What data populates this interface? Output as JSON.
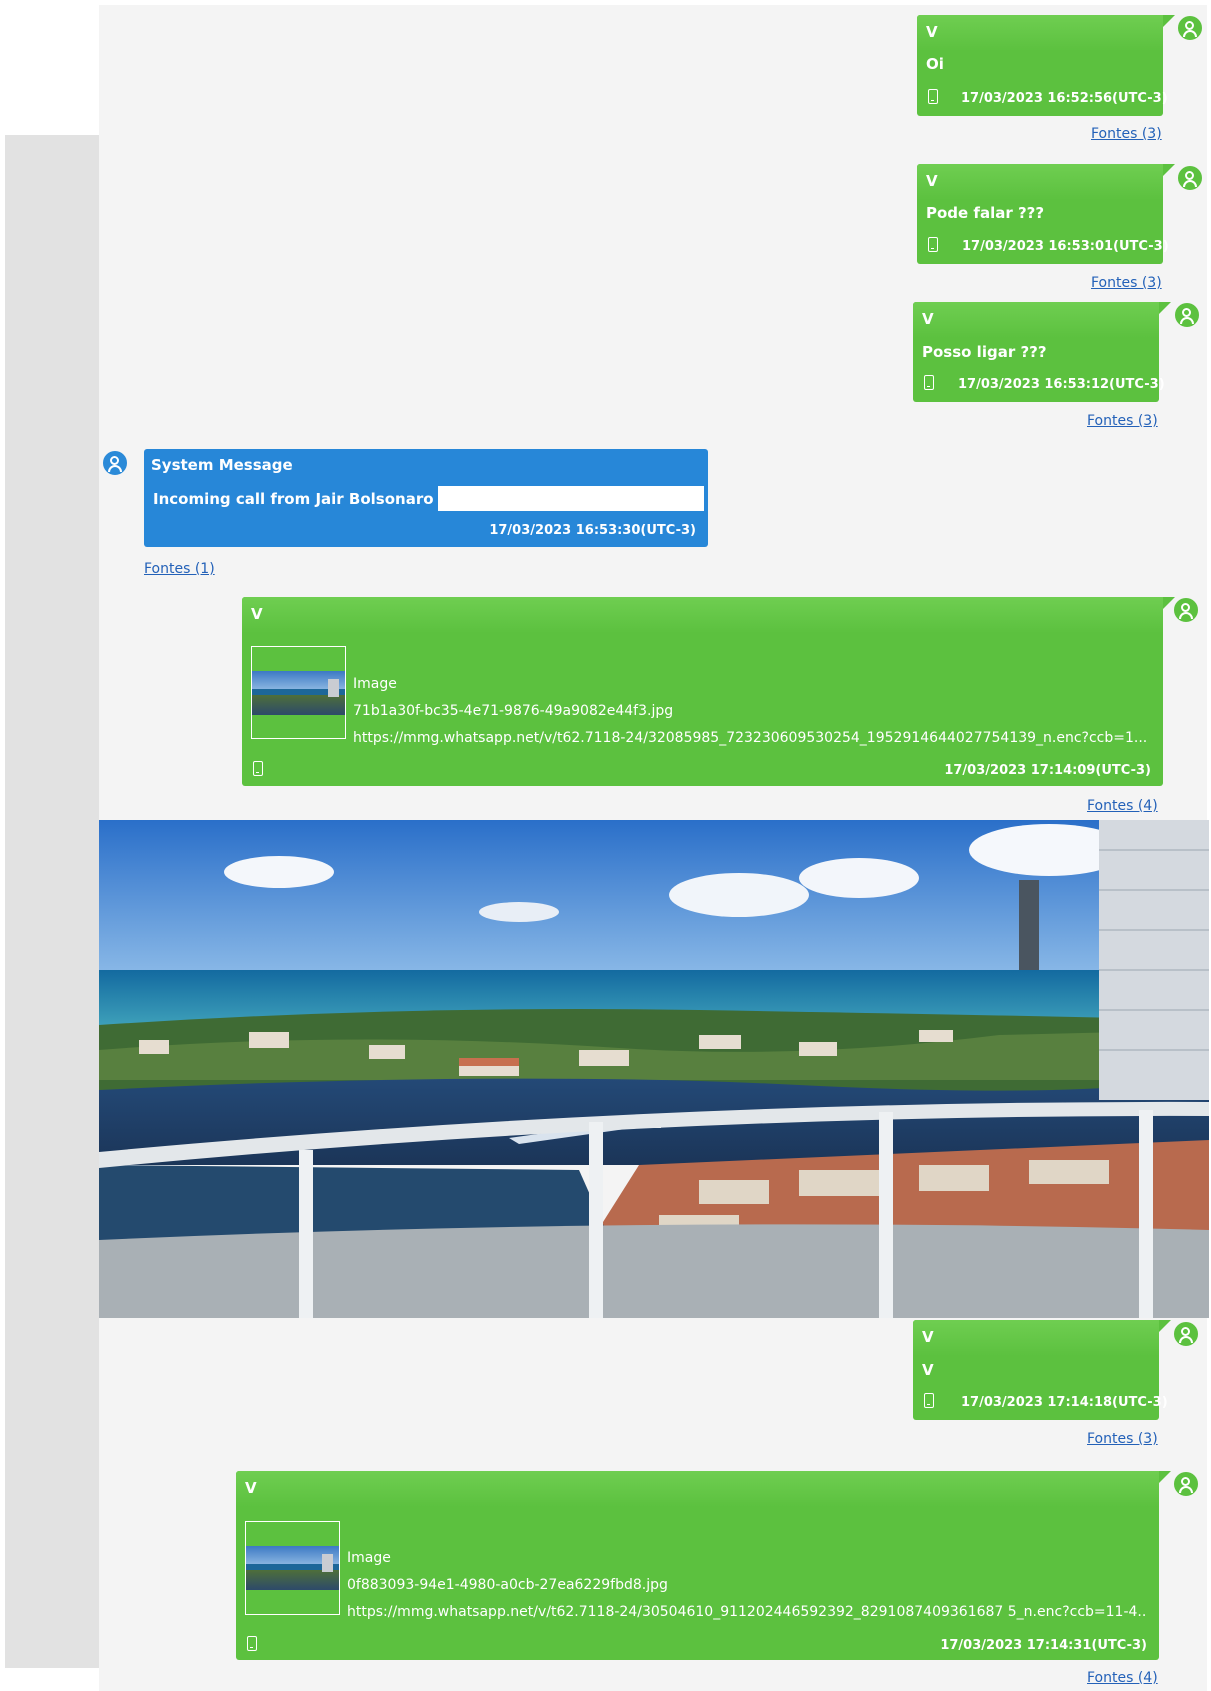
{
  "colors": {
    "outgoing_bubble": "#5cc13f",
    "system_bubble": "#2787d8",
    "link": "#2361b8",
    "panel_bg": "#f4f4f4"
  },
  "messages": [
    {
      "sender": "V",
      "text": "Oi",
      "timestamp": "17/03/2023 16:52:56(UTC-3)",
      "sources": "Fontes (3)"
    },
    {
      "sender": "V",
      "text": "Pode falar  ???",
      "timestamp": "17/03/2023 16:53:01(UTC-3)",
      "sources": "Fontes (3)"
    },
    {
      "sender": "V",
      "text": "Posso ligar  ???",
      "timestamp": "17/03/2023 16:53:12(UTC-3)",
      "sources": "Fontes (3)"
    }
  ],
  "system_message": {
    "title": "System Message",
    "text": "Incoming call from Jair Bolsonaro 5",
    "timestamp": "17/03/2023 16:53:30(UTC-3)",
    "sources": "Fontes (1)"
  },
  "image_message_1": {
    "sender": "V",
    "type_label": "Image",
    "filename": "71b1a30f-bc35-4e71-9876-49a9082e44f3.jpg",
    "url": "https://mmg.whatsapp.net/v/t62.7118-24/32085985_723230609530254_1952914644027754139_n.enc?ccb=1...",
    "timestamp": "17/03/2023 17:14:09(UTC-3)",
    "sources": "Fontes (4)"
  },
  "message_v": {
    "sender": "V",
    "text": "V",
    "timestamp": "17/03/2023 17:14:18(UTC-3)",
    "sources": "Fontes (3)"
  },
  "image_message_2": {
    "sender": "V",
    "type_label": "Image",
    "filename": "0f883093-94e1-4980-a0cb-27ea6229fbd8.jpg",
    "url": "https://mmg.whatsapp.net/v/t62.7118-24/30504610_911202446592392_8291087409361687 5_n.enc?ccb=11-4...",
    "timestamp": "17/03/2023 17:14:31(UTC-3)",
    "sources": "Fontes (4)"
  },
  "icons": {
    "avatar": "person-avatar-icon",
    "device": "phone-icon"
  }
}
